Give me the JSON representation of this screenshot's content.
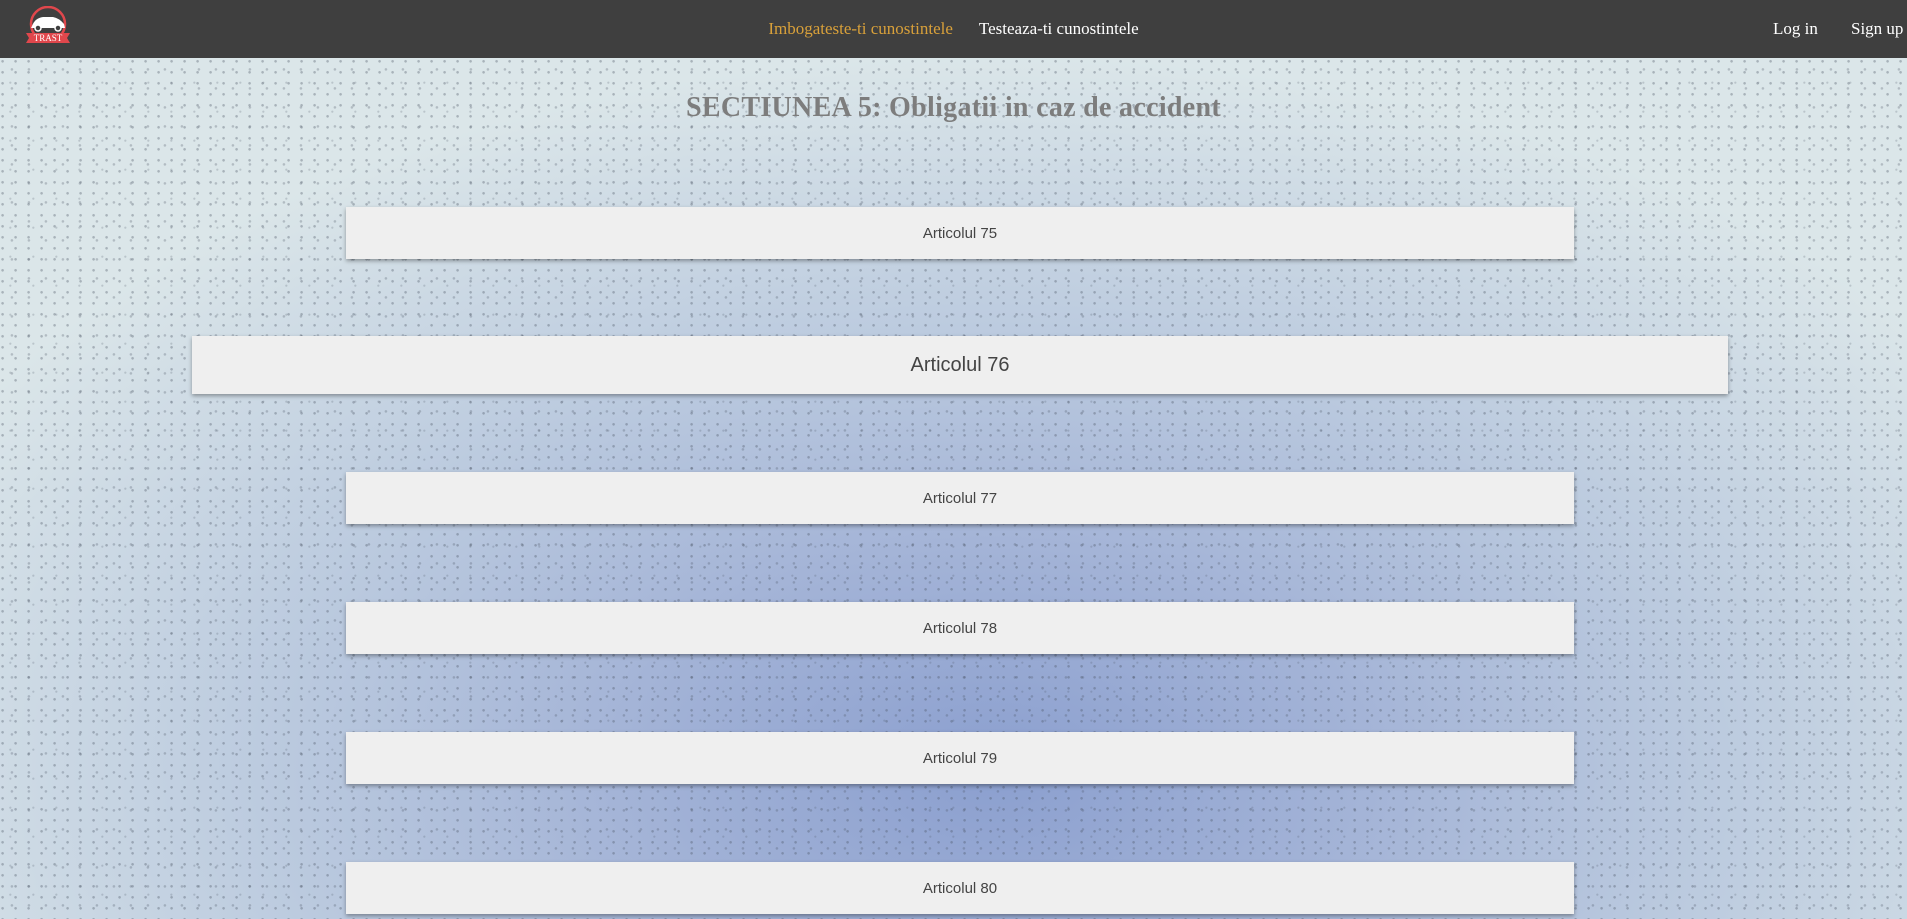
{
  "app": {
    "logo_text": "TRAST"
  },
  "navbar": {
    "links": [
      {
        "label": "Imbogateste-ti cunostintele",
        "active": true
      },
      {
        "label": "Testeaza-ti cunostintele",
        "active": false
      }
    ],
    "login_label": "Log in",
    "signup_label": "Sign up"
  },
  "page": {
    "title": "SECTIUNEA 5: Obligatii in caz de accident"
  },
  "articles": [
    {
      "label": "Articolul 75",
      "expanded": false
    },
    {
      "label": "Articolul 76",
      "expanded": true
    },
    {
      "label": "Articolul 77",
      "expanded": false
    },
    {
      "label": "Articolul 78",
      "expanded": false
    },
    {
      "label": "Articolul 79",
      "expanded": false
    },
    {
      "label": "Articolul 80",
      "expanded": false
    }
  ],
  "colors": {
    "navbar_bg": "#3f3f3f",
    "active_link": "#d8a03a",
    "link": "#ffffff",
    "title": "#7d7d7d",
    "article_bg": "#efefef",
    "article_text": "#444444",
    "logo_red": "#e0474c"
  }
}
